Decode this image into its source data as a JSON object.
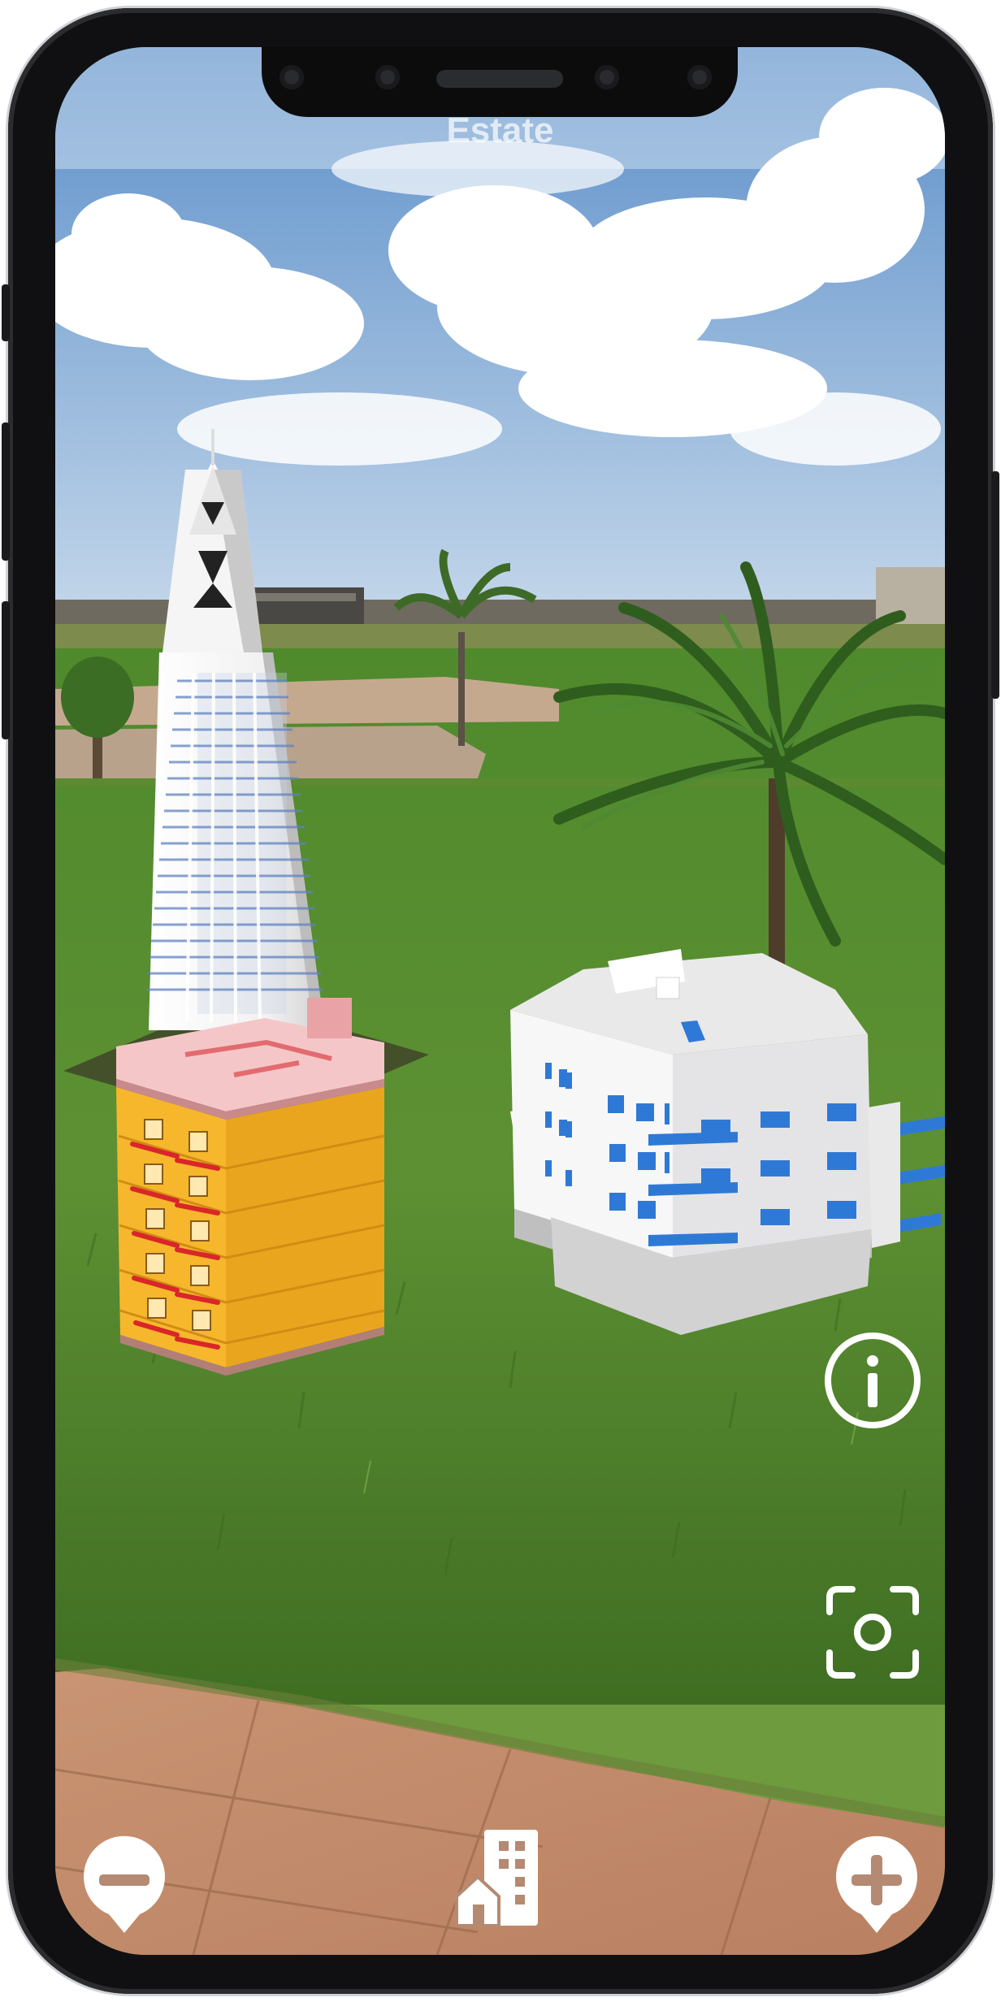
{
  "app": {
    "header_text": "Estate",
    "controls": {
      "info_icon": "info-icon",
      "capture_icon": "camera-focus-icon",
      "zoom_out_icon": "zoom-out-pin-icon",
      "catalog_icon": "buildings-catalog-icon",
      "zoom_in_icon": "zoom-in-pin-icon"
    },
    "models": [
      "skyscraper-model",
      "orange-apartment-model",
      "white-apartment-model"
    ]
  },
  "colors": {
    "sky": "#7fa9d8",
    "grass": "#5f8f34",
    "path": "#c48d6b",
    "orange_building": "#f2b22a",
    "balcony_blue": "#2f79d6",
    "balcony_red": "#d9262a",
    "icon_white": "#ffffff"
  }
}
